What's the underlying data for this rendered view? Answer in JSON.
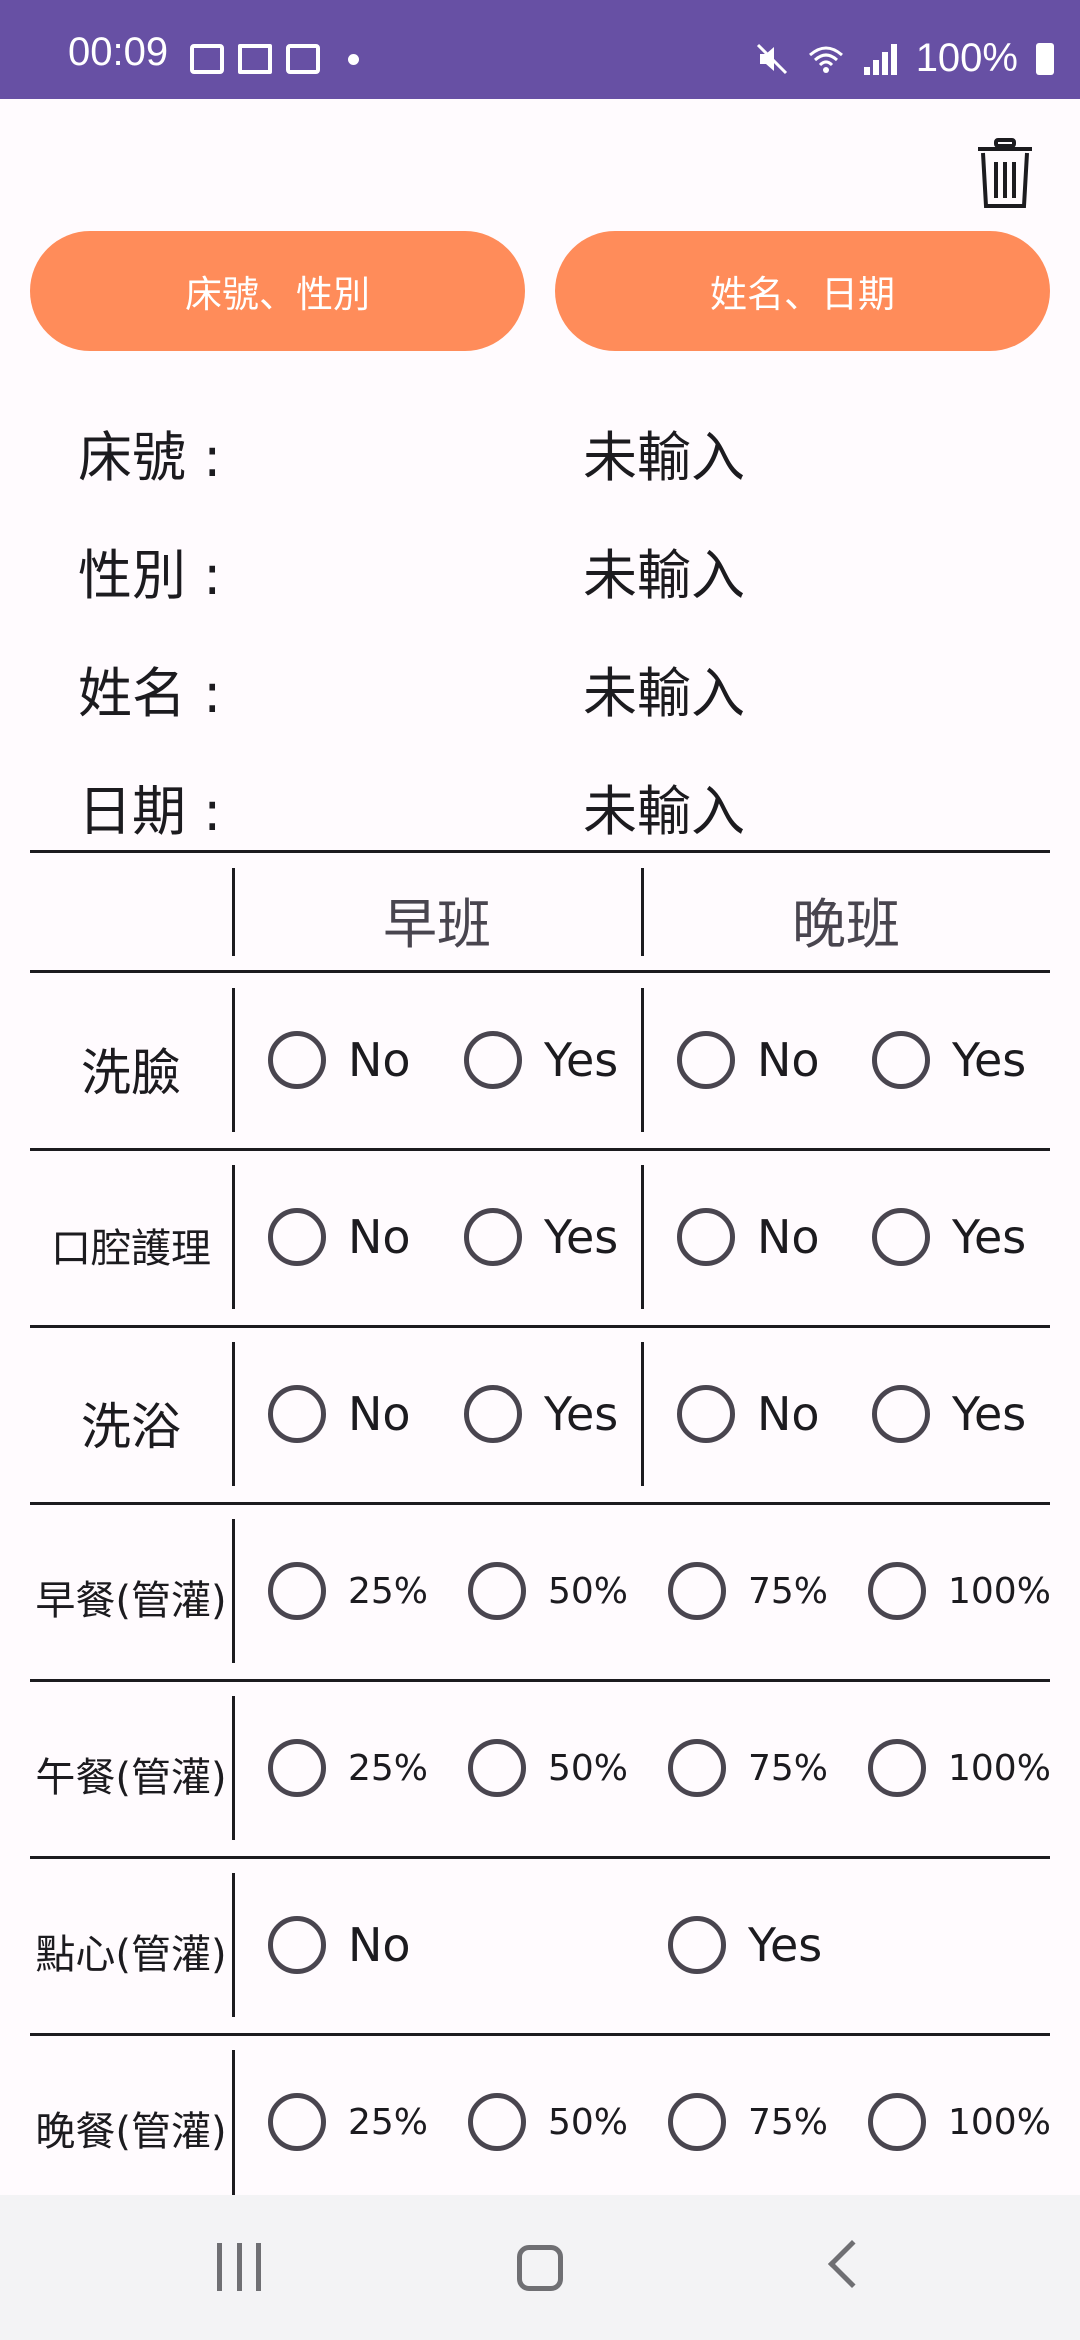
{
  "status_bar": {
    "time": "00:09",
    "battery": "100%",
    "accent": "#6750a4"
  },
  "actions": {
    "btn_bed_gender": "床號、性別",
    "btn_name_date": "姓名、日期",
    "accent": "#ff8c5a"
  },
  "info": [
    {
      "label": "床號 :",
      "value": "未輸入"
    },
    {
      "label": "性別 :",
      "value": "未輸入"
    },
    {
      "label": "姓名 :",
      "value": "未輸入"
    },
    {
      "label": "日期 :",
      "value": "未輸入"
    }
  ],
  "table": {
    "headers": [
      "早班",
      "晚班"
    ],
    "rows": [
      {
        "label": "洗臉",
        "options": [
          "No",
          "Yes",
          "No",
          "Yes"
        ]
      },
      {
        "label": "口腔護理",
        "options": [
          "No",
          "Yes",
          "No",
          "Yes"
        ]
      },
      {
        "label": "洗浴",
        "options": [
          "No",
          "Yes",
          "No",
          "Yes"
        ]
      },
      {
        "label": "早餐(管灌)",
        "options": [
          "25%",
          "50%",
          "75%",
          "100%"
        ]
      },
      {
        "label": "午餐(管灌)",
        "options": [
          "25%",
          "50%",
          "75%",
          "100%"
        ]
      },
      {
        "label": "點心(管灌)",
        "options": [
          "No",
          "Yes"
        ]
      },
      {
        "label": "晚餐(管灌)",
        "options": [
          "25%",
          "50%",
          "75%",
          "100%"
        ]
      }
    ]
  },
  "icons": {
    "trash": "trash-icon",
    "nav_recent": "recent-apps-icon",
    "nav_home": "home-icon",
    "nav_back": "back-icon"
  }
}
